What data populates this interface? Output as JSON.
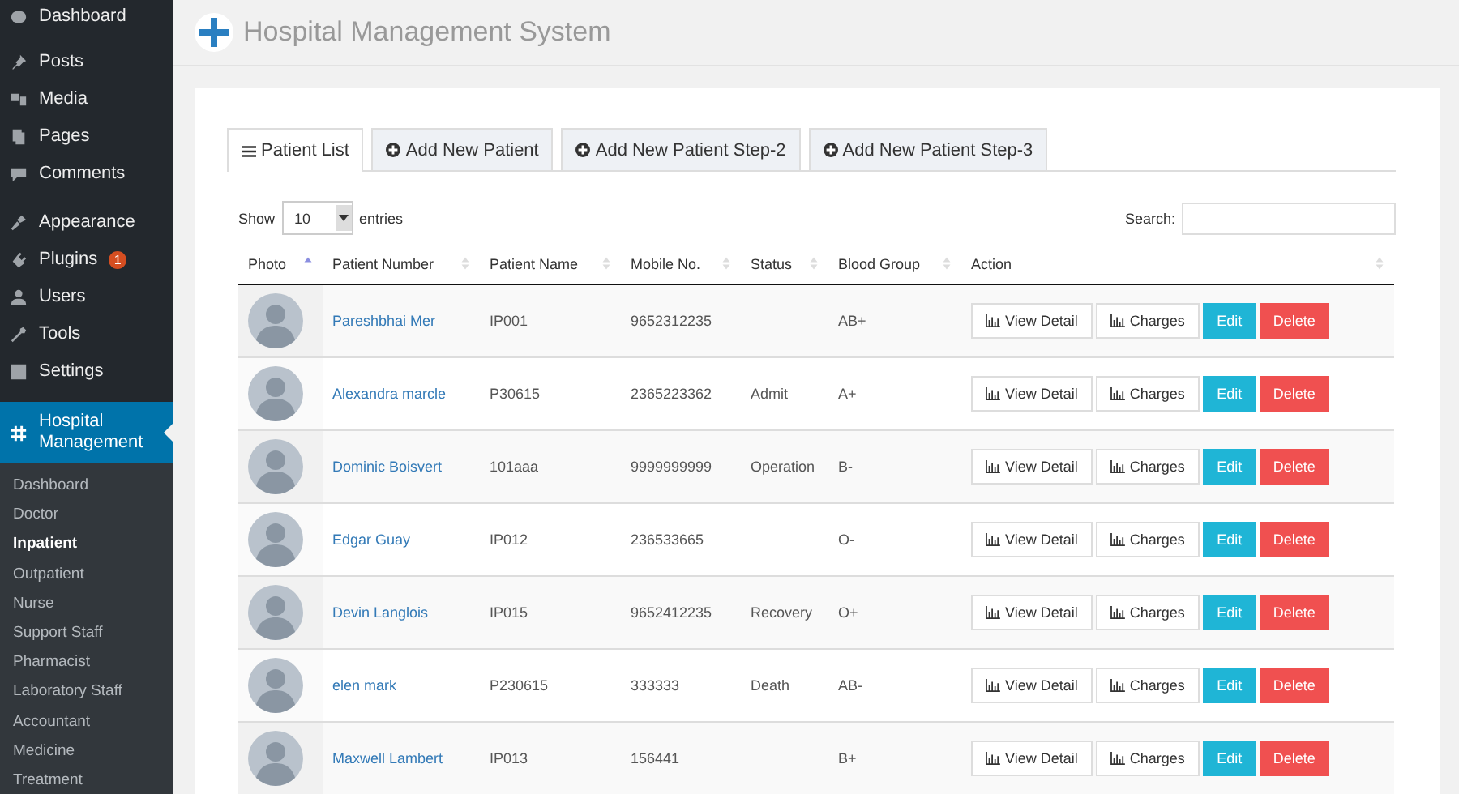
{
  "sidebar": {
    "menu": [
      {
        "label": "Dashboard",
        "selected": false
      },
      {
        "label": "Posts",
        "selected": false
      },
      {
        "label": "Media",
        "selected": false
      },
      {
        "label": "Pages",
        "selected": false
      },
      {
        "label": "Comments",
        "selected": false
      },
      {
        "label": "Appearance",
        "selected": false
      },
      {
        "label": "Plugins",
        "badge": "1",
        "selected": false
      },
      {
        "label": "Users",
        "selected": false
      },
      {
        "label": "Tools",
        "selected": false
      },
      {
        "label": "Settings",
        "selected": false
      },
      {
        "label": "Hospital Management",
        "selected": true
      }
    ],
    "submenu": [
      {
        "label": "Dashboard",
        "selected": false
      },
      {
        "label": "Doctor",
        "selected": false
      },
      {
        "label": "Inpatient",
        "selected": true
      },
      {
        "label": "Outpatient",
        "selected": false
      },
      {
        "label": "Nurse",
        "selected": false
      },
      {
        "label": "Support Staff",
        "selected": false
      },
      {
        "label": "Pharmacist",
        "selected": false
      },
      {
        "label": "Laboratory Staff",
        "selected": false
      },
      {
        "label": "Accountant",
        "selected": false
      },
      {
        "label": "Medicine",
        "selected": false
      },
      {
        "label": "Treatment",
        "selected": false
      }
    ]
  },
  "header": {
    "title": "Hospital Management System"
  },
  "tabs": [
    {
      "label": "Patient List",
      "selected": true
    },
    {
      "label": "Add New Patient",
      "selected": false
    },
    {
      "label": "Add New Patient Step-2",
      "selected": false
    },
    {
      "label": "Add New Patient Step-3",
      "selected": false
    }
  ],
  "length_control": {
    "prefix": "Show",
    "value": "10",
    "suffix": "entries"
  },
  "search": {
    "label": "Search:"
  },
  "table": {
    "columns": [
      {
        "label": "Photo",
        "sorted": true
      },
      {
        "label": "Patient Number",
        "sorted": false
      },
      {
        "label": "Patient Name",
        "sorted": false
      },
      {
        "label": "Mobile No.",
        "sorted": false
      },
      {
        "label": "Status",
        "sorted": false
      },
      {
        "label": "Blood Group",
        "sorted": false
      },
      {
        "label": "Action",
        "sorted": false
      }
    ],
    "rows": [
      {
        "name": "Pareshbhai Mer",
        "number": "IP001",
        "mobile": "9652312235",
        "status": "",
        "blood": "AB+",
        "actions": [
          {
            "kind": "detail",
            "label": "View Detail"
          },
          {
            "kind": "charges",
            "label": "Charges"
          },
          {
            "kind": "edit",
            "label": "Edit"
          },
          {
            "kind": "delete",
            "label": "Delete"
          }
        ]
      },
      {
        "name": "Alexandra marcle",
        "number": "P30615",
        "mobile": "2365223362",
        "status": "Admit",
        "blood": "A+",
        "actions": [
          {
            "kind": "detail",
            "label": "View Detail"
          },
          {
            "kind": "charges",
            "label": "Charges"
          },
          {
            "kind": "edit",
            "label": "Edit"
          },
          {
            "kind": "delete",
            "label": "Delete"
          }
        ]
      },
      {
        "name": "Dominic Boisvert",
        "number": "101aaa",
        "mobile": "9999999999",
        "status": "Operation",
        "blood": "B-",
        "actions": [
          {
            "kind": "detail",
            "label": "View Detail"
          },
          {
            "kind": "charges",
            "label": "Charges"
          },
          {
            "kind": "edit",
            "label": "Edit"
          },
          {
            "kind": "delete",
            "label": "Delete"
          }
        ]
      },
      {
        "name": "Edgar Guay",
        "number": "IP012",
        "mobile": "236533665",
        "status": "",
        "blood": "O-",
        "actions": [
          {
            "kind": "detail",
            "label": "View Detail"
          },
          {
            "kind": "charges",
            "label": "Charges"
          },
          {
            "kind": "edit",
            "label": "Edit"
          },
          {
            "kind": "delete",
            "label": "Delete"
          }
        ]
      },
      {
        "name": "Devin Langlois",
        "number": "IP015",
        "mobile": "9652412235",
        "status": "Recovery",
        "blood": "O+",
        "actions": [
          {
            "kind": "detail",
            "label": "View Detail"
          },
          {
            "kind": "charges",
            "label": "Charges"
          },
          {
            "kind": "edit",
            "label": "Edit"
          },
          {
            "kind": "delete",
            "label": "Delete"
          }
        ]
      },
      {
        "name": "elen mark",
        "number": "P230615",
        "mobile": "333333",
        "status": "Death",
        "blood": "AB-",
        "actions": [
          {
            "kind": "detail",
            "label": "View Detail"
          },
          {
            "kind": "charges",
            "label": "Charges"
          },
          {
            "kind": "edit",
            "label": "Edit"
          },
          {
            "kind": "delete",
            "label": "Delete"
          }
        ]
      },
      {
        "name": "Maxwell Lambert",
        "number": "IP013",
        "mobile": "156441",
        "status": "",
        "blood": "B+",
        "actions": [
          {
            "kind": "detail",
            "label": "View Detail"
          },
          {
            "kind": "charges",
            "label": "Charges"
          },
          {
            "kind": "edit",
            "label": "Edit"
          },
          {
            "kind": "delete",
            "label": "Delete"
          }
        ]
      }
    ]
  }
}
